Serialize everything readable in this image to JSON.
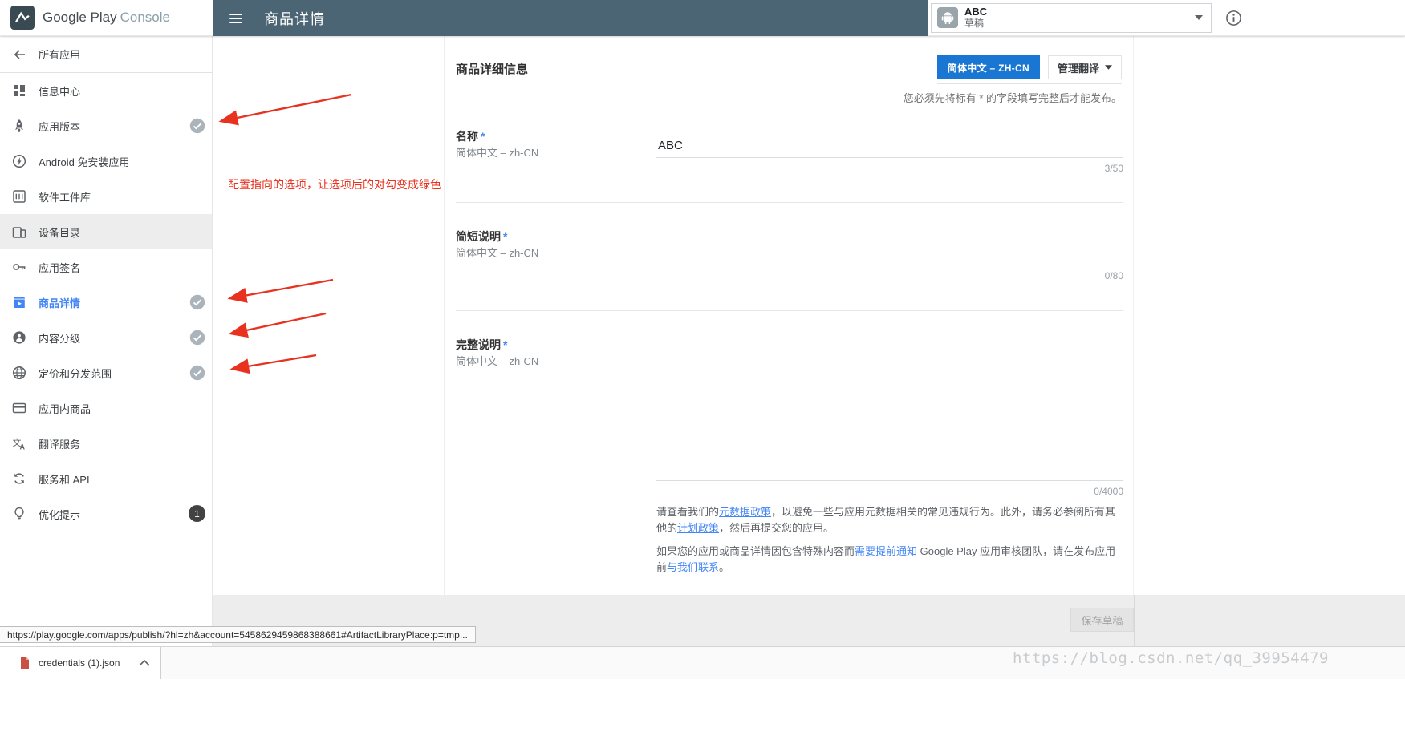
{
  "brand": {
    "name_primary": "Google Play",
    "name_secondary": "Console"
  },
  "header": {
    "title": "商品详情",
    "app": {
      "name": "ABC",
      "status": "草稿"
    }
  },
  "sidebar": {
    "back_label": "所有应用",
    "items": [
      {
        "label": "信息中心",
        "icon": "dashboard-icon"
      },
      {
        "label": "应用版本",
        "icon": "rocket-icon",
        "checked": true
      },
      {
        "label": "Android 免安装应用",
        "icon": "instant-bolt-icon"
      },
      {
        "label": "软件工件库",
        "icon": "artifact-library-icon"
      },
      {
        "label": "设备目录",
        "icon": "devices-icon"
      },
      {
        "label": "应用签名",
        "icon": "key-icon"
      },
      {
        "label": "商品详情",
        "icon": "storefront-icon",
        "checked": true,
        "active": true
      },
      {
        "label": "内容分级",
        "icon": "person-circle-icon",
        "checked": true
      },
      {
        "label": "定价和分发范围",
        "icon": "globe-icon",
        "checked": true
      },
      {
        "label": "应用内商品",
        "icon": "credit-card-icon"
      },
      {
        "label": "翻译服务",
        "icon": "translate-icon"
      },
      {
        "label": "服务和 API",
        "icon": "sync-icon"
      },
      {
        "label": "优化提示",
        "icon": "lightbulb-icon",
        "badge": "1"
      }
    ]
  },
  "annotation": {
    "note": "配置指向的选项，让选项后的对勾变成绿色",
    "arrow_color": "#e8321f"
  },
  "listing": {
    "section_title": "商品详细信息",
    "language_button": "简体中文 – ZH-CN",
    "manage_translations_button": "管理翻译",
    "required_hint": "您必须先将标有 * 的字段填写完整后才能发布。",
    "fields": {
      "name": {
        "label": "名称",
        "required_mark": "*",
        "language": "简体中文 – zh-CN",
        "value": "ABC",
        "counter": "3/50"
      },
      "short_description": {
        "label": "简短说明",
        "required_mark": "*",
        "language": "简体中文 – zh-CN",
        "value": "",
        "counter": "0/80"
      },
      "full_description": {
        "label": "完整说明",
        "required_mark": "*",
        "language": "简体中文 – zh-CN",
        "value": "",
        "counter": "0/4000"
      }
    },
    "policy_paragraph_1": {
      "text_1": "请查看我们的",
      "link_1": "元数据政策",
      "text_2": "，以避免一些与应用元数据相关的常见违规行为。此外，请务必参阅所有其他的",
      "link_2": "计划政策",
      "text_3": "，然后再提交您的应用。"
    },
    "policy_paragraph_2": {
      "text_1": "如果您的应用或商品详情因包含特殊内容而",
      "link_1": "需要提前通知",
      "text_2": " Google Play 应用审核团队，请在发布应用前",
      "link_2": "与我们联系",
      "text_3": "。"
    },
    "save_button": "保存草稿"
  },
  "statusbar": {
    "url": "https://play.google.com/apps/publish/?hl=zh&account=5458629459868388661#ArtifactLibraryPlace:p=tmp..."
  },
  "downloads": {
    "filename": "credentials (1).json"
  },
  "watermark": "https://blog.csdn.net/qq_39954479",
  "colors": {
    "header_bar": "#4b6574",
    "accent_blue": "#4285f4",
    "language_button_blue": "#1976d2",
    "annotation_red": "#e8321f",
    "check_gray": "#aab4ba",
    "badge_dark": "#424242"
  }
}
